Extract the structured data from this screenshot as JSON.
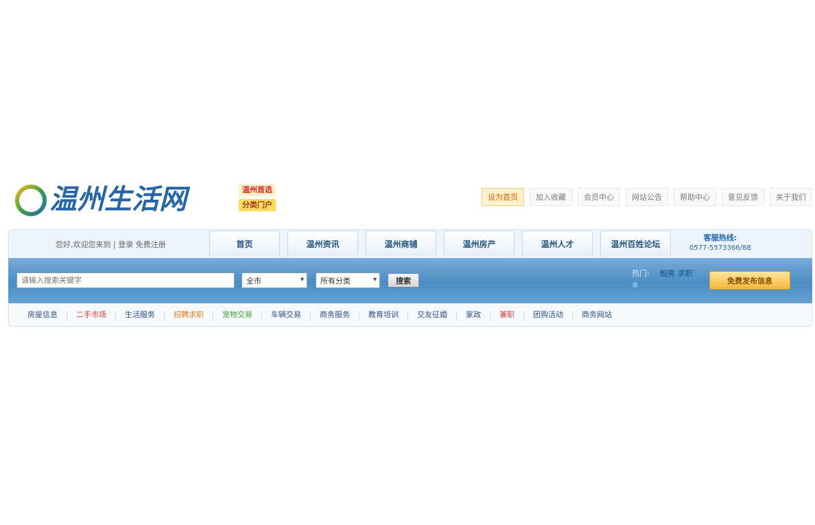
{
  "logo": {
    "text": "温州生活网"
  },
  "badges": [
    "温州首选",
    "分类门户"
  ],
  "top_links": [
    {
      "label": "设为首页",
      "active": true
    },
    {
      "label": "加入收藏",
      "active": false
    },
    {
      "label": "会员中心",
      "active": false
    },
    {
      "label": "网站公告",
      "active": false
    },
    {
      "label": "帮助中心",
      "active": false
    },
    {
      "label": "意见反馈",
      "active": false
    },
    {
      "label": "关于我们",
      "active": false
    }
  ],
  "nav": {
    "welcome": "您好,欢迎您来到 | 登录 免费注册",
    "tabs": [
      "首页",
      "温州资讯",
      "温州商铺",
      "温州房产",
      "温州人才",
      "温州百姓论坛"
    ],
    "hotline_title": "客服热线:",
    "hotline_number": "0577-5573366/88"
  },
  "search": {
    "placeholder": "请输入搜索关键字",
    "area": "全市",
    "category": "所有分类",
    "button": "搜索",
    "hot_label": "热门:",
    "hot_link": "租房 求职",
    "post_button": "免费发布信息"
  },
  "categories": [
    {
      "label": "房屋信息",
      "color": "#2c4f86"
    },
    {
      "label": "二手市场",
      "color": "#d83c3c"
    },
    {
      "label": "生活服务",
      "color": "#2c4f86"
    },
    {
      "label": "招聘求职",
      "color": "#e27d1b"
    },
    {
      "label": "宠物交易",
      "color": "#3c9d39"
    },
    {
      "label": "车辆交易",
      "color": "#2c4f86"
    },
    {
      "label": "商务服务",
      "color": "#2c4f86"
    },
    {
      "label": "教育培训",
      "color": "#2c4f86"
    },
    {
      "label": "交友征婚",
      "color": "#2c4f86"
    },
    {
      "label": "家政",
      "color": "#2c4f86"
    },
    {
      "label": "兼职",
      "color": "#d83c3c"
    },
    {
      "label": "团购活动",
      "color": "#2c4f86"
    },
    {
      "label": "商务网站",
      "color": "#2c4f86"
    }
  ]
}
